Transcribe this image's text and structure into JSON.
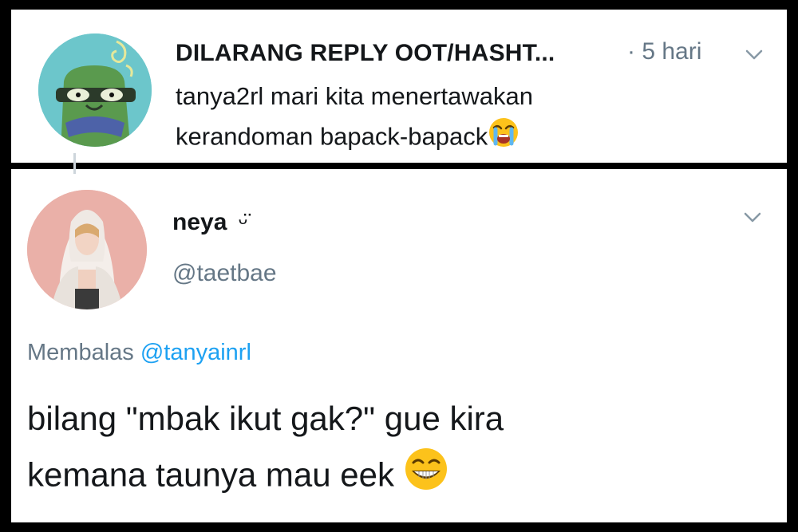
{
  "tweet_parent": {
    "name": "DILARANG REPLY OOT/HASHT...",
    "time": "· 5 hari",
    "text_line1": "tanya2rl mari kita menertawakan",
    "text_line2": "kerandoman bapack-bapack",
    "emoji": "loudly-crying-face"
  },
  "tweet_reply": {
    "name": "neya",
    "name_suffix": "ᵕ̈",
    "handle": "@taetbae",
    "reply_prefix": "Membalas",
    "reply_mention": "@tanyainrl",
    "text_line1": "bilang \"mbak ikut gak?\" gue kira",
    "text_line2": "kemana taunya mau eek",
    "emoji": "grinning-squinting-face"
  },
  "colors": {
    "text": "#14171a",
    "secondary": "#657786",
    "link": "#1da1f2",
    "frame": "#000000"
  }
}
